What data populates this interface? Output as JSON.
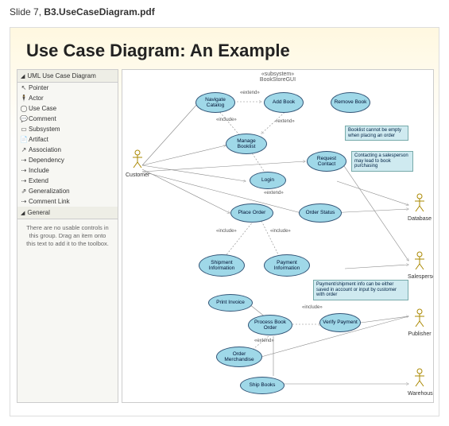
{
  "header": {
    "prefix": "Slide 7, ",
    "filename": "B3.UseCaseDiagram.pdf"
  },
  "slide": {
    "title": "Use Case Diagram: An Example"
  },
  "toolbox": {
    "group1": {
      "title": "UML Use Case Diagram"
    },
    "items": [
      {
        "icon": "↖",
        "label": "Pointer"
      },
      {
        "icon": "🕴",
        "label": "Actor"
      },
      {
        "icon": "◯",
        "label": "Use Case"
      },
      {
        "icon": "💬",
        "label": "Comment"
      },
      {
        "icon": "▭",
        "label": "Subsystem"
      },
      {
        "icon": "📄",
        "label": "Artifact"
      },
      {
        "icon": "↗",
        "label": "Association"
      },
      {
        "icon": "⇢",
        "label": "Dependency"
      },
      {
        "icon": "⇢",
        "label": "Include"
      },
      {
        "icon": "⇢",
        "label": "Extend"
      },
      {
        "icon": "⇗",
        "label": "Generalization"
      },
      {
        "icon": "⇢",
        "label": "Comment Link"
      }
    ],
    "group2": {
      "title": "General"
    },
    "footer": "There are no usable controls in this group. Drag an item onto this text to add it to the toolbox."
  },
  "diagram": {
    "subsystem_stereo": "«subsystem»",
    "subsystem_name": "BookStoreGUI",
    "actors": {
      "customer": "Customer",
      "database": "Database",
      "salesperson": "Salesperson",
      "publisher": "Publisher",
      "warehouse": "Warehouse"
    },
    "usecases": {
      "navigate": "Navigate Catalog",
      "addbook": "Add Book",
      "removebook": "Remove Book",
      "managebooklist": "Manage Booklist",
      "login": "Login",
      "requestcontact": "Request Contact",
      "placeorder": "Place Order",
      "orderstatus": "Order Status",
      "shipmentinfo": "Shipment Information",
      "paymentinfo": "Payment Information",
      "printinvoice": "Print Invoice",
      "processbook": "Process Book Order",
      "verifypayment": "Verify Payment",
      "ordermerch": "Order Merchandise",
      "shipbooks": "Ship Books"
    },
    "notes": {
      "booklist_empty": "Booklist cannot be empty when placing an order",
      "contact_sales": "Contacting a salesperson may lead to book purchasing",
      "payment_ship": "Payment/shipment info can be either saved in account or input by customer with order"
    },
    "stereos": {
      "extend": "«extend»",
      "include": "«include»"
    }
  }
}
